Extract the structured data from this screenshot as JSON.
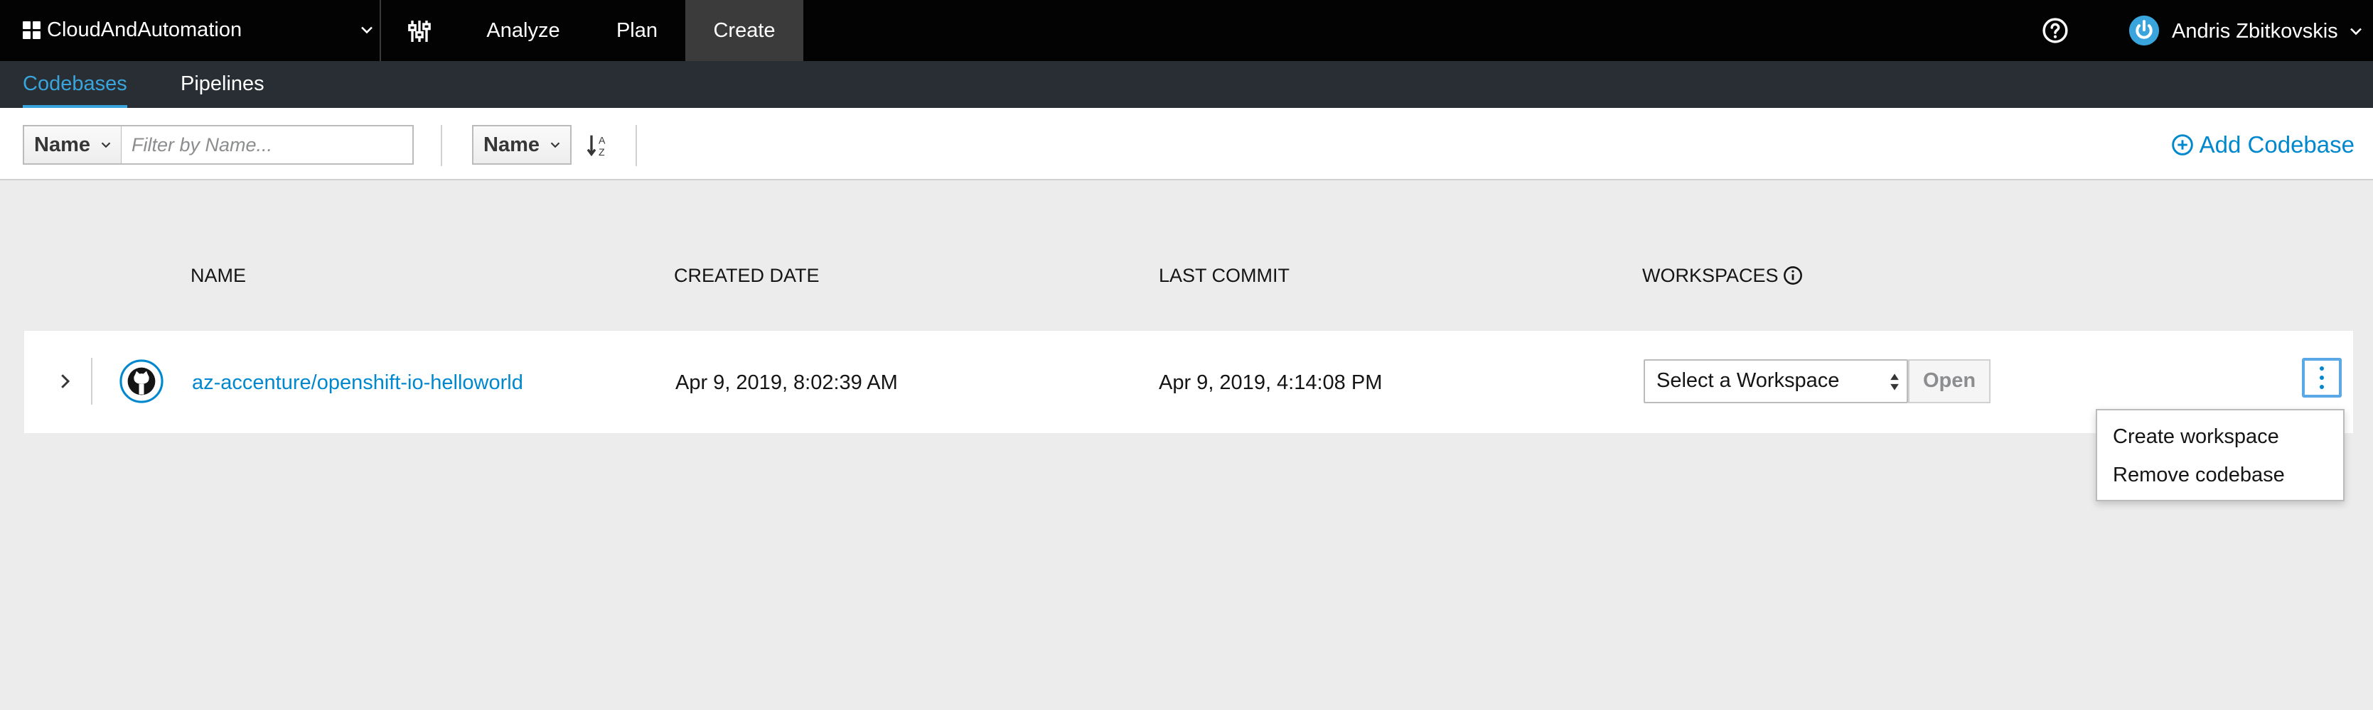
{
  "topbar": {
    "context_name": "CloudAndAutomation",
    "nav": {
      "analyze": "Analyze",
      "plan": "Plan",
      "create": "Create"
    },
    "active_nav": "Create",
    "user_name": "Andris Zbitkovskis"
  },
  "subnav": {
    "tabs": [
      "Codebases",
      "Pipelines"
    ],
    "active_tab": "Codebases"
  },
  "toolbar": {
    "filter_field": "Name",
    "filter_placeholder": "Filter by Name...",
    "sort_field": "Name",
    "add_codebase_label": "Add Codebase"
  },
  "table": {
    "headers": {
      "name": "NAME",
      "created": "CREATED DATE",
      "last_commit": "LAST COMMIT",
      "workspaces": "WORKSPACES"
    },
    "rows": [
      {
        "name": "az-accenture/openshift-io-helloworld",
        "created": "Apr 9, 2019, 8:02:39 AM",
        "last_commit": "Apr 9, 2019, 4:14:08 PM",
        "workspace_select": "Select a Workspace",
        "open_label": "Open"
      }
    ]
  },
  "row_menu": {
    "items": [
      "Create workspace",
      "Remove codebase"
    ]
  },
  "colors": {
    "accent": "#39a5dc",
    "link": "#0088ce",
    "topbar_bg": "#030303",
    "subnav_bg": "#292e34",
    "page_bg": "#ececec"
  },
  "icons": [
    "grid-icon",
    "chevron-down-icon",
    "filter-sliders-icon",
    "help-icon",
    "power-avatar-icon",
    "sort-alpha-icon",
    "plus-circle-icon",
    "info-icon",
    "chevron-right-icon",
    "github-icon",
    "kebab-icon"
  ]
}
